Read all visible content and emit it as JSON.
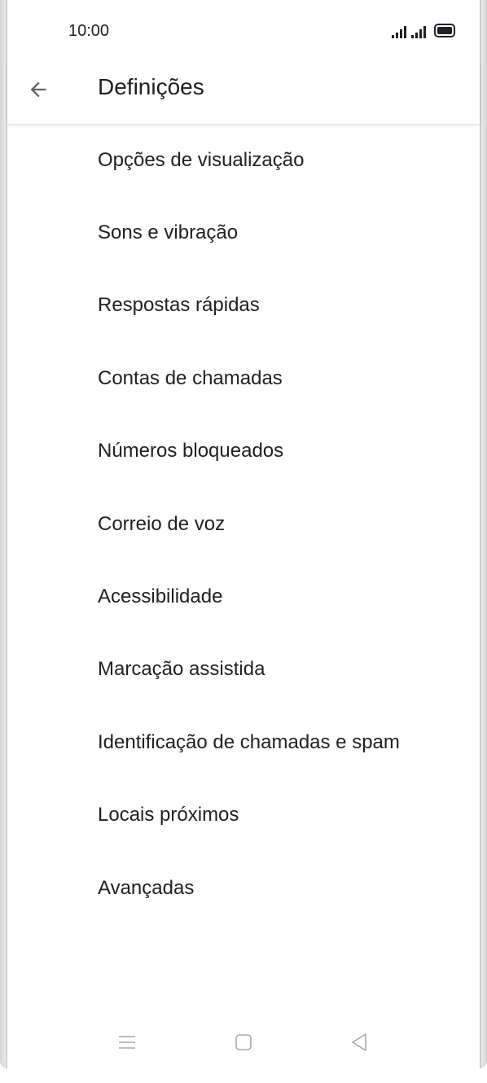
{
  "status_bar": {
    "time": "10:00",
    "icons": [
      "signal-icon",
      "signal-icon",
      "battery-icon"
    ]
  },
  "app_bar": {
    "back_icon": "arrow-left-icon",
    "title": "Definições"
  },
  "settings": {
    "items": [
      {
        "label": "Opções de visualização"
      },
      {
        "label": "Sons e vibração"
      },
      {
        "label": "Respostas rápidas"
      },
      {
        "label": "Contas de chamadas"
      },
      {
        "label": "Números bloqueados"
      },
      {
        "label": "Correio de voz"
      },
      {
        "label": "Acessibilidade"
      },
      {
        "label": "Marcação assistida"
      },
      {
        "label": "Identificação de chamadas e spam"
      },
      {
        "label": "Locais próximos"
      },
      {
        "label": "Avançadas"
      }
    ]
  },
  "nav_bar": {
    "icons": [
      "menu-icon",
      "home-icon",
      "back-triangle-icon"
    ]
  },
  "colors": {
    "text": "#202124",
    "icon": "#5f6368",
    "nav_icon": "#a8a8a8",
    "background": "#ffffff"
  }
}
